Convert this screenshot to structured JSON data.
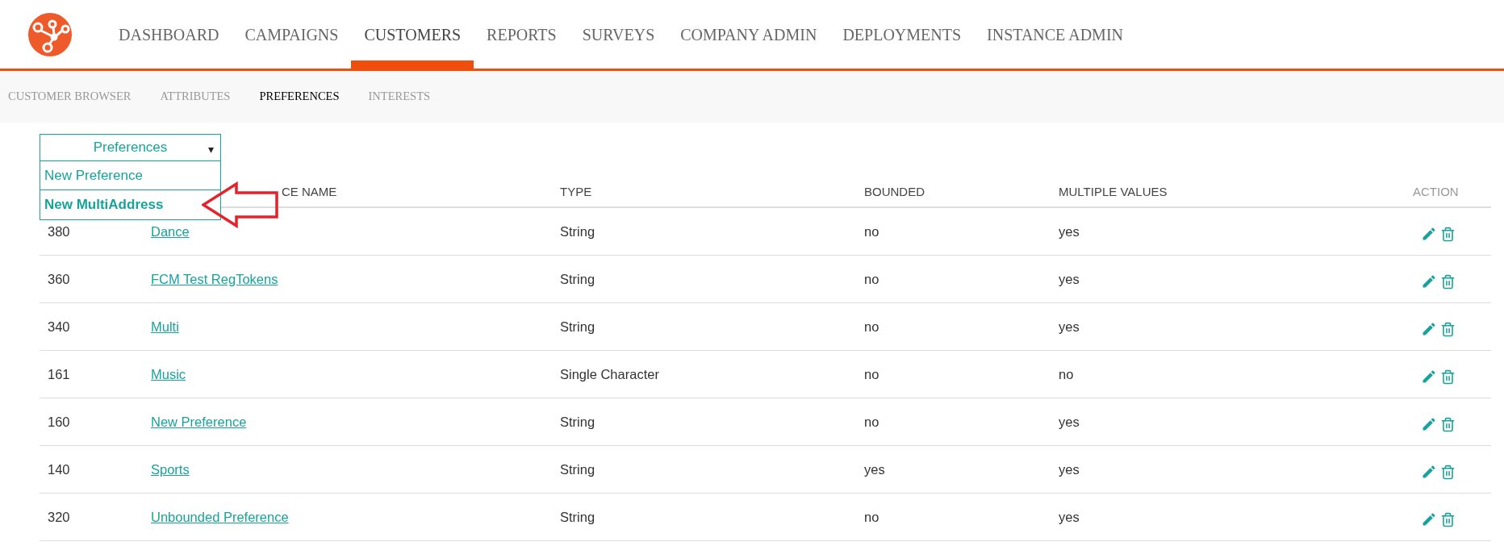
{
  "nav": {
    "items": [
      {
        "label": "DASHBOARD",
        "selected": false
      },
      {
        "label": "CAMPAIGNS",
        "selected": false
      },
      {
        "label": "CUSTOMERS",
        "selected": true
      },
      {
        "label": "REPORTS",
        "selected": false
      },
      {
        "label": "SURVEYS",
        "selected": false
      },
      {
        "label": "COMPANY ADMIN",
        "selected": false
      },
      {
        "label": "DEPLOYMENTS",
        "selected": false
      },
      {
        "label": "INSTANCE ADMIN",
        "selected": false
      }
    ]
  },
  "subnav": {
    "items": [
      {
        "label": "CUSTOMER BROWSER",
        "selected": false
      },
      {
        "label": "ATTRIBUTES",
        "selected": false
      },
      {
        "label": "PREFERENCES",
        "selected": true
      },
      {
        "label": "INTERESTS",
        "selected": false
      }
    ]
  },
  "dropdown": {
    "label": "Preferences",
    "caret": "▾",
    "items": [
      {
        "label": "New Preference",
        "selected": false
      },
      {
        "label": "New MultiAddress",
        "selected": true
      }
    ]
  },
  "table": {
    "columns": [
      "CE NAME",
      "TYPE",
      "BOUNDED",
      "MULTIPLE VALUES",
      "ACTION"
    ],
    "rows": [
      {
        "id": "380",
        "name": "Dance",
        "type": "String",
        "bounded": "no",
        "multiple": "yes"
      },
      {
        "id": "360",
        "name": "FCM Test RegTokens",
        "type": "String",
        "bounded": "no",
        "multiple": "yes"
      },
      {
        "id": "340",
        "name": "Multi",
        "type": "String",
        "bounded": "no",
        "multiple": "yes"
      },
      {
        "id": "161",
        "name": "Music",
        "type": "Single Character",
        "bounded": "no",
        "multiple": "no"
      },
      {
        "id": "160",
        "name": "New Preference",
        "type": "String",
        "bounded": "no",
        "multiple": "yes"
      },
      {
        "id": "140",
        "name": "Sports",
        "type": "String",
        "bounded": "yes",
        "multiple": "yes"
      },
      {
        "id": "320",
        "name": "Unbounded Preference",
        "type": "String",
        "bounded": "no",
        "multiple": "yes"
      }
    ]
  }
}
